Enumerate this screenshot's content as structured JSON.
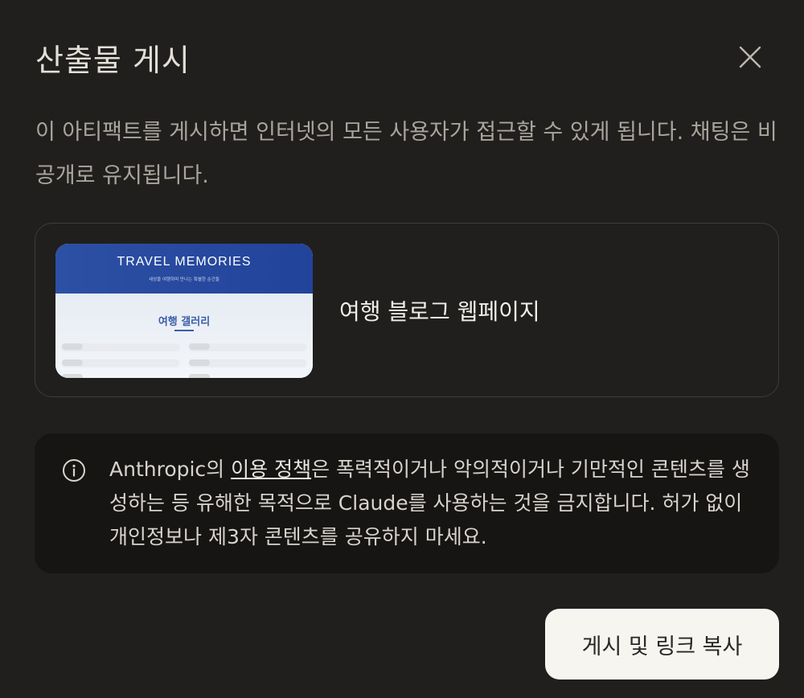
{
  "dialog": {
    "title": "산출물 게시",
    "description": "이 아티팩트를 게시하면 인터넷의 모든 사용자가 접근할 수 있게 됩니다. 채팅은 비공개로 유지됩니다.",
    "close_icon": "close-icon"
  },
  "artifact": {
    "name": "여행 블로그 웹페이지",
    "thumbnail": {
      "title": "TRAVEL MEMORIES",
      "subtitle": "세상을 여행하며 만나는 특별한 순간들",
      "gallery_heading": "여행 갤러리",
      "header_color": "#2c50a4"
    }
  },
  "notice": {
    "icon": "info-icon",
    "prefix": "Anthropic의 ",
    "link_text": "이용 정책",
    "suffix": "은 폭력적이거나 악의적이거나 기만적인 콘텐츠를 생성하는 등 유해한 목적으로 Claude를 사용하는 것을 금지합니다. 허가 없이 개인정보나 제3자 콘텐츠를 공유하지 마세요."
  },
  "actions": {
    "publish_label": "게시 및 링크 복사"
  },
  "colors": {
    "background": "#201f1e",
    "notice_bg": "#161514",
    "button_bg": "#f7f5ef"
  }
}
